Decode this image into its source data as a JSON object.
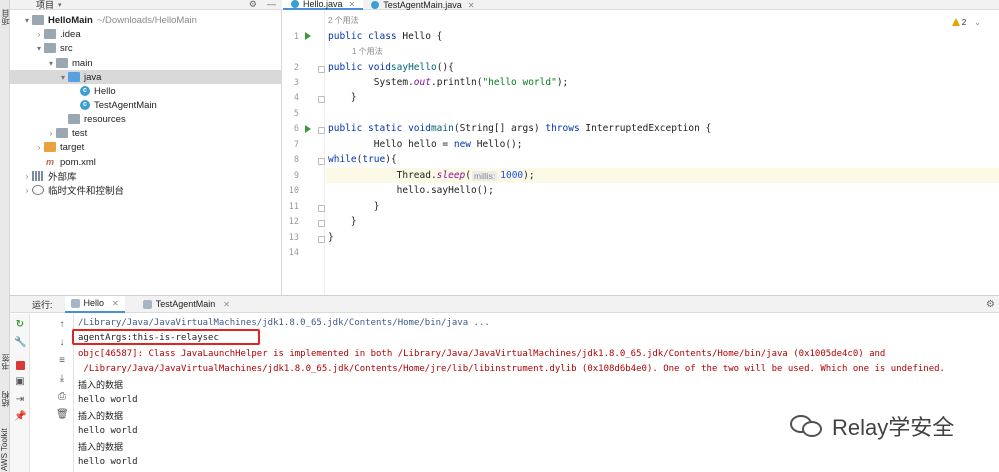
{
  "edge_strip": {
    "top_label": "项目",
    "bottom_labels": [
      "书签",
      "结构",
      "AWS Toolkit"
    ]
  },
  "project": {
    "header_label": "项目",
    "tree": [
      {
        "label": "HelloMain",
        "extra": "~/Downloads/HelloMain",
        "level": 0,
        "arrow": "▾",
        "icon": "folder",
        "bold": true
      },
      {
        "label": ".idea",
        "level": 1,
        "arrow": "›",
        "icon": "folder"
      },
      {
        "label": "src",
        "level": 1,
        "arrow": "▾",
        "icon": "folder"
      },
      {
        "label": "main",
        "level": 2,
        "arrow": "▾",
        "icon": "folder"
      },
      {
        "label": "java",
        "level": 3,
        "arrow": "▾",
        "icon": "folder-blue",
        "selected": true
      },
      {
        "label": "Hello",
        "level": 4,
        "arrow": "",
        "icon": "class"
      },
      {
        "label": "TestAgentMain",
        "level": 4,
        "arrow": "",
        "icon": "class"
      },
      {
        "label": "resources",
        "level": 3,
        "arrow": "",
        "icon": "folder-res"
      },
      {
        "label": "test",
        "level": 2,
        "arrow": "›",
        "icon": "folder"
      },
      {
        "label": "target",
        "level": 1,
        "arrow": "›",
        "icon": "folder-orange"
      },
      {
        "label": "pom.xml",
        "level": 1,
        "arrow": "",
        "icon": "maven"
      },
      {
        "label": "外部库",
        "level": 0,
        "arrow": "›",
        "icon": "lib"
      },
      {
        "label": "临时文件和控制台",
        "level": 0,
        "arrow": "›",
        "icon": "scratch"
      }
    ]
  },
  "editor": {
    "tabs": [
      {
        "label": "Hello.java",
        "active": true
      },
      {
        "label": "TestAgentMain.java",
        "active": false
      }
    ],
    "warnings": "2",
    "usage_hint_class": "2 个用法",
    "usage_hint_method": "1 个用法",
    "line_numbers": [
      "1",
      "2",
      "3",
      "4",
      "5",
      "6",
      "7",
      "8",
      "9",
      "10",
      "11",
      "12",
      "13",
      "14"
    ],
    "inlay_millis": "millis:"
  },
  "run": {
    "label": "运行:",
    "tabs": [
      {
        "label": "Hello",
        "active": true
      },
      {
        "label": "TestAgentMain",
        "active": false
      }
    ],
    "console": [
      {
        "text": "/Library/Java/JavaVirtualMachines/jdk1.8.0_65.jdk/Contents/Home/bin/java ...",
        "kind": "path"
      },
      {
        "text": "agentArgs:this-is-relaysec",
        "kind": "normal"
      },
      {
        "text": "objc[46587]: Class JavaLaunchHelper is implemented in both /Library/Java/JavaVirtualMachines/jdk1.8.0_65.jdk/Contents/Home/bin/java (0x1005de4c0) and",
        "kind": "err"
      },
      {
        "text": " /Library/Java/JavaVirtualMachines/jdk1.8.0_65.jdk/Contents/Home/jre/lib/libinstrument.dylib (0x108d6b4e0). One of the two will be used. Which one is undefined.",
        "kind": "err"
      },
      {
        "text": "插入的数据",
        "kind": "cn"
      },
      {
        "text": "hello world",
        "kind": "normal"
      },
      {
        "text": "插入的数据",
        "kind": "cn"
      },
      {
        "text": "hello world",
        "kind": "normal"
      },
      {
        "text": "插入的数据",
        "kind": "cn"
      },
      {
        "text": "hello world",
        "kind": "normal"
      }
    ]
  },
  "watermark": {
    "text": "Relay学安全"
  }
}
